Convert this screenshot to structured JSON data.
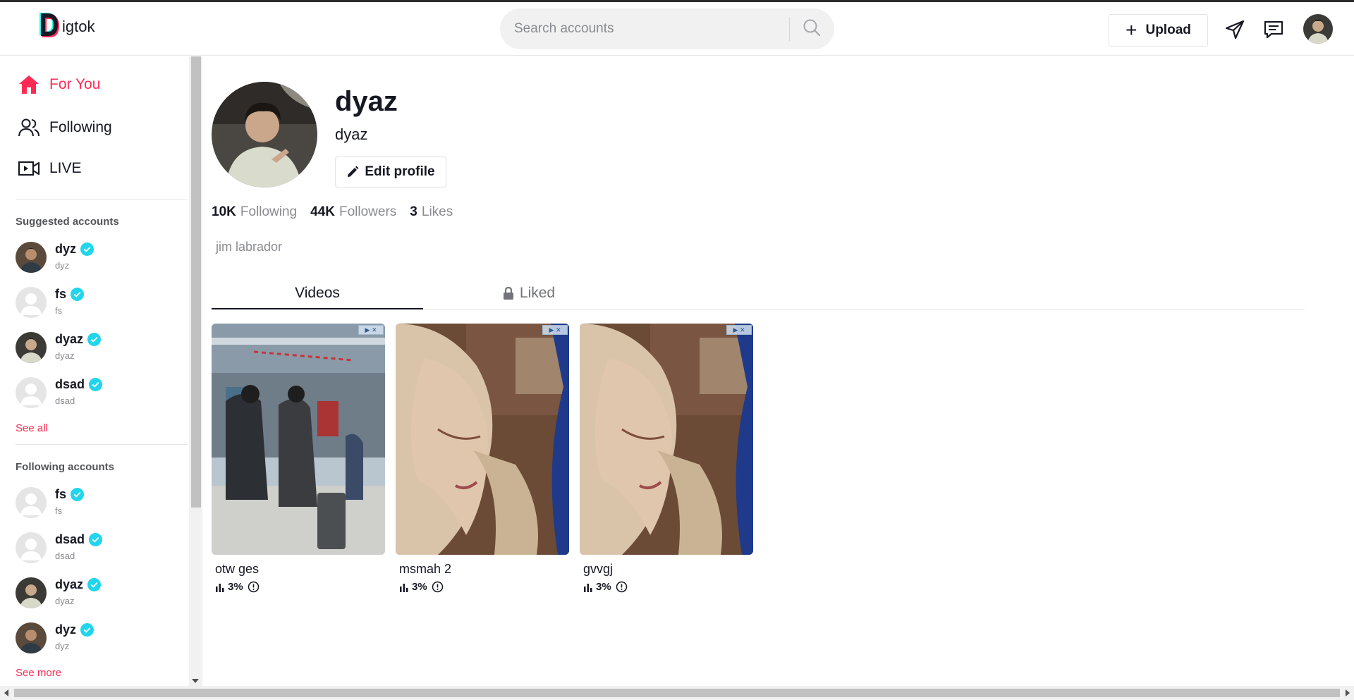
{
  "app": {
    "logo_text": "igtok",
    "colors": {
      "accent": "#fe2c55",
      "verified": "#20d5ec",
      "text": "#161823",
      "muted": "#8a8b91"
    }
  },
  "header": {
    "search": {
      "placeholder": "Search accounts",
      "value": "",
      "icon": "search-icon"
    },
    "upload_label": "Upload",
    "icons": [
      "send-icon",
      "inbox-icon",
      "avatar"
    ]
  },
  "sidebar": {
    "nav": [
      {
        "label": "For You",
        "icon": "home-icon",
        "active": true
      },
      {
        "label": "Following",
        "icon": "users-icon",
        "active": false
      },
      {
        "label": "LIVE",
        "icon": "live-video-icon",
        "active": false
      }
    ],
    "suggested_heading": "Suggested accounts",
    "suggested": [
      {
        "username": "dyz",
        "nickname": "dyz",
        "verified": true,
        "avatar": "photo"
      },
      {
        "username": "fs",
        "nickname": "fs",
        "verified": true,
        "avatar": "default"
      },
      {
        "username": "dyaz",
        "nickname": "dyaz",
        "verified": true,
        "avatar": "photo"
      },
      {
        "username": "dsad",
        "nickname": "dsad",
        "verified": true,
        "avatar": "default"
      }
    ],
    "see_all": "See all",
    "following_heading": "Following accounts",
    "following": [
      {
        "username": "fs",
        "nickname": "fs",
        "verified": true,
        "avatar": "default"
      },
      {
        "username": "dsad",
        "nickname": "dsad",
        "verified": true,
        "avatar": "default"
      },
      {
        "username": "dyaz",
        "nickname": "dyaz",
        "verified": true,
        "avatar": "photo"
      },
      {
        "username": "dyz",
        "nickname": "dyz",
        "verified": true,
        "avatar": "photo"
      }
    ],
    "see_more": "See more"
  },
  "profile": {
    "username": "dyaz",
    "nickname": "dyaz",
    "edit_label": "Edit profile",
    "stats": [
      {
        "value": "10K",
        "label": "Following"
      },
      {
        "value": "44K",
        "label": "Followers"
      },
      {
        "value": "3",
        "label": "Likes"
      }
    ],
    "bio": "jim labrador",
    "tabs": [
      {
        "label": "Videos",
        "active": true,
        "icon": ""
      },
      {
        "label": "Liked",
        "active": false,
        "icon": "lock-icon"
      }
    ]
  },
  "videos": [
    {
      "title": "otw ges",
      "views": "3%"
    },
    {
      "title": "msmah 2",
      "views": "3%"
    },
    {
      "title": "gvvgj",
      "views": "3%"
    }
  ]
}
